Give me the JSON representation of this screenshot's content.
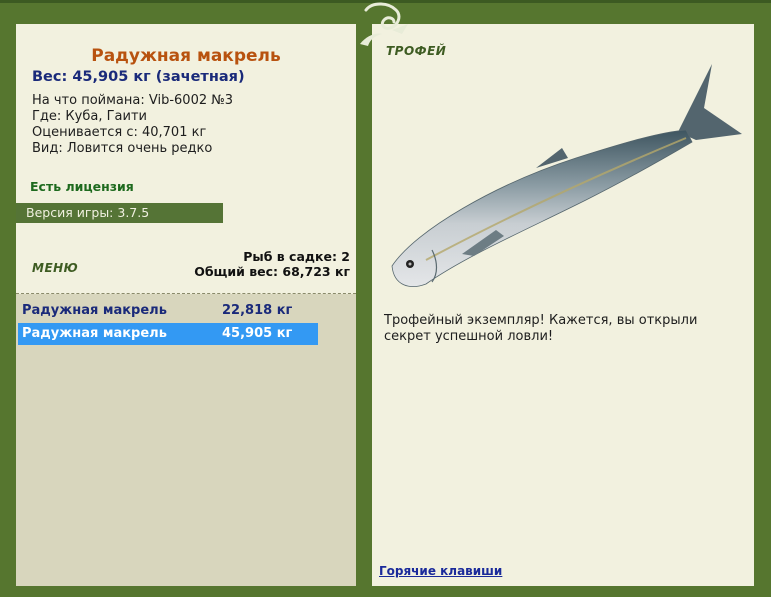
{
  "fish": {
    "title": "Радужная макрель",
    "weight": "Вес: 45,905 кг (зачетная)",
    "caught_with": "На что поймана: Vib-6002 №3",
    "location": "Где: Куба, Гаити",
    "valued_from": "Оценивается с: 40,701 кг",
    "type": "Вид: Ловится очень редко"
  },
  "license": "Есть лицензия",
  "version": "Версия игры: 3.7.5",
  "menu": {
    "title": "МЕНЮ",
    "cage_count": "Рыб в садке: 2",
    "total_weight": "Общий вес: 68,723 кг"
  },
  "catch_list": [
    {
      "name": "Радужная макрель",
      "weight": "22,818 кг",
      "selected": false
    },
    {
      "name": "Радужная макрель",
      "weight": "45,905 кг",
      "selected": true
    }
  ],
  "trophy": {
    "title": "ТРОФЕЙ",
    "description": "Трофейный экземпляр! Кажется, вы открыли секрет успешной ловли!",
    "hotkeys_link": "Горячие клавиши"
  },
  "colors": {
    "frame": "#56762f",
    "panel": "#f2f1df",
    "selection": "#3399f3",
    "title_orange": "#b8520f",
    "weight_blue": "#1a2a7a"
  }
}
